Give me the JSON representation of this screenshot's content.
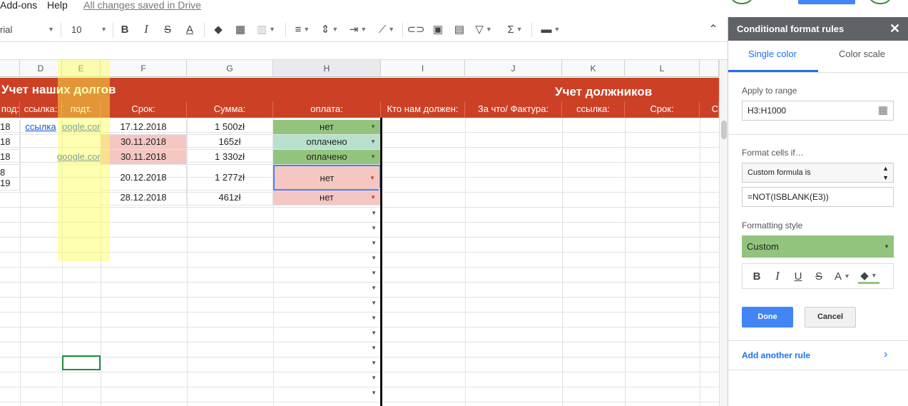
{
  "menu": {
    "addons": "Add-ons",
    "help": "Help",
    "saved": "All changes saved in Drive"
  },
  "toolbar": {
    "font": "rial",
    "size": "10"
  },
  "columns": [
    "D",
    "E",
    "F",
    "G",
    "H",
    "I",
    "J",
    "K",
    "L"
  ],
  "sheet": {
    "title_left": "Учет наших долгов",
    "title_right": "Учет должников",
    "headers_left": [
      "под:",
      "ссылка:",
      "подт.",
      "Срок:",
      "Сумма:",
      "оплата:"
    ],
    "headers_right": [
      "Кто нам должен:",
      "За что/ Фактура:",
      "ссылка:",
      "Срок:",
      "С"
    ],
    "rows": [
      {
        "c": "18",
        "d": "ссылка",
        "e": "oogle.cor",
        "f": "17.12.2018",
        "g": "1 500zł",
        "h": "нет"
      },
      {
        "c": "18",
        "d": "",
        "e": "",
        "f": "30.11.2018",
        "g": "165zł",
        "h": "оплачено"
      },
      {
        "c": "18",
        "d": "",
        "e": "google.cor",
        "f": "30.11.2018",
        "g": "1 330zł",
        "h": "оплачено"
      },
      {
        "c": "8\n19",
        "d": "",
        "e": "",
        "f": "20.12.2018",
        "g": "1 277zł",
        "h": "нет"
      },
      {
        "c": "",
        "d": "",
        "e": "",
        "f": "28.12.2018",
        "g": "461zł",
        "h": "нет"
      }
    ]
  },
  "colors": {
    "red_header": "#cc4125",
    "green": "#93c47d",
    "light_green": "#b7e1cd",
    "pink": "#f4c7c3",
    "highlight": "#ffff99",
    "blue": "#4285f4"
  },
  "panel": {
    "title": "Conditional format rules",
    "tab_single": "Single color",
    "tab_scale": "Color scale",
    "apply_label": "Apply to range",
    "range": "H3:H1000",
    "format_if_label": "Format cells if…",
    "condition": "Custom formula is",
    "formula": "=NOT(ISBLANK(E3))",
    "style_label": "Formatting style",
    "style_value": "Custom",
    "done": "Done",
    "cancel": "Cancel",
    "add_rule": "Add another rule"
  }
}
